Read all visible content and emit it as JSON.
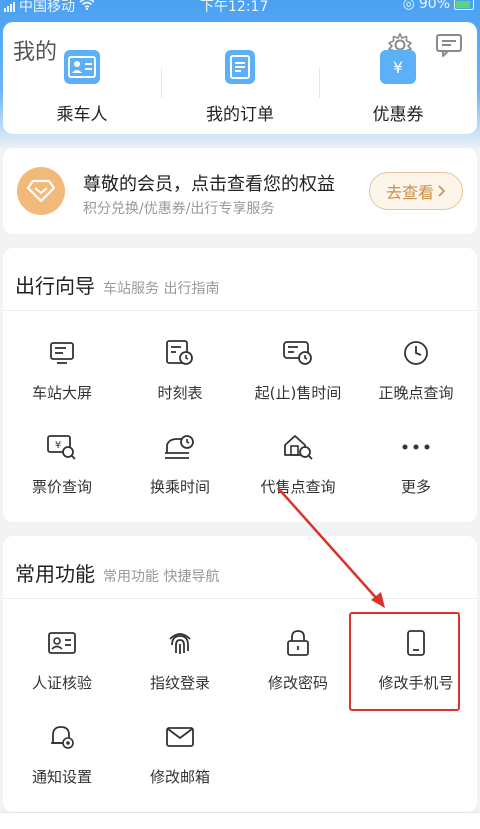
{
  "status_bar": {
    "carrier": "中国移动",
    "time": "下午12:17",
    "battery": "90%"
  },
  "mine": {
    "title": "我的",
    "items": [
      {
        "label": "乘车人",
        "icon": "passenger-card-icon"
      },
      {
        "label": "我的订单",
        "icon": "order-list-icon"
      },
      {
        "label": "优惠券",
        "icon": "coupon-icon"
      }
    ],
    "right_icons": [
      "settings-gear-icon",
      "message-icon"
    ]
  },
  "vip": {
    "title": "尊敬的会员，点击查看您的权益",
    "subtitle": "积分兑换/优惠券/出行专享服务",
    "button": "去查看",
    "icon": "diamond-icon"
  },
  "guide": {
    "title": "出行向导",
    "subtitle": "车站服务 出行指南",
    "items": [
      {
        "label": "车站大屏",
        "icon": "station-screen-icon"
      },
      {
        "label": "时刻表",
        "icon": "timetable-icon"
      },
      {
        "label": "起(止)售时间",
        "icon": "sale-time-icon"
      },
      {
        "label": "正晚点查询",
        "icon": "clock-icon"
      },
      {
        "label": "票价查询",
        "icon": "fare-search-icon"
      },
      {
        "label": "换乘时间",
        "icon": "transfer-time-icon"
      },
      {
        "label": "代售点查询",
        "icon": "agency-search-icon"
      },
      {
        "label": "更多",
        "icon": "more-dots-icon"
      }
    ]
  },
  "common": {
    "title": "常用功能",
    "subtitle": "常用功能 快捷导航",
    "items": [
      {
        "label": "人证核验",
        "icon": "id-verify-icon"
      },
      {
        "label": "指纹登录",
        "icon": "fingerprint-icon"
      },
      {
        "label": "修改密码",
        "icon": "lock-icon"
      },
      {
        "label": "修改手机号",
        "icon": "phone-icon"
      },
      {
        "label": "通知设置",
        "icon": "bell-settings-icon"
      },
      {
        "label": "修改邮箱",
        "icon": "mail-icon"
      }
    ]
  },
  "colors": {
    "accent": "#4aa0f2",
    "highlight": "#d9342b",
    "vip": "#f2b97a"
  }
}
